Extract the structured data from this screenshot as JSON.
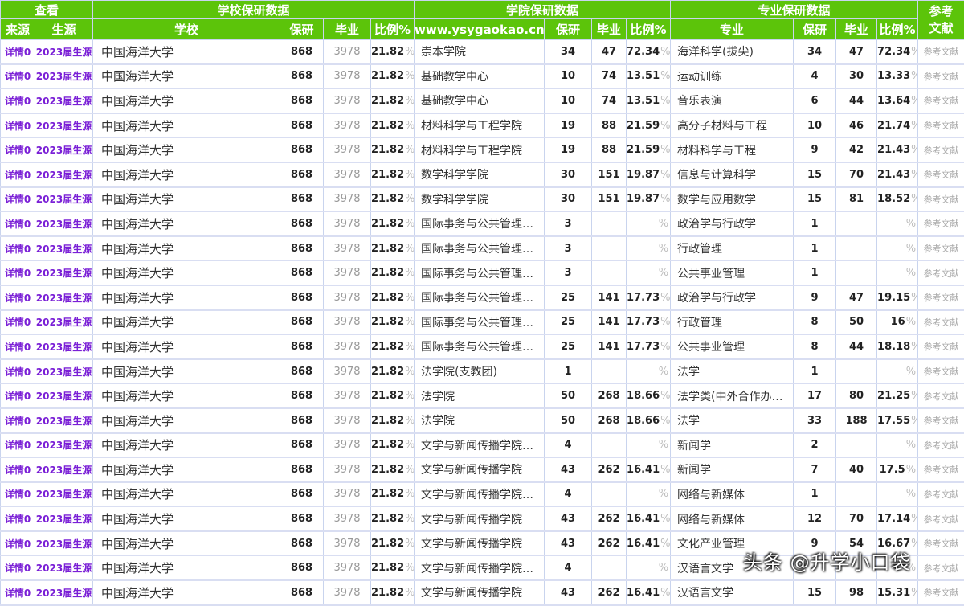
{
  "header": {
    "view": "查看",
    "school_group": "学校保研数据",
    "college_group": "学院保研数据",
    "major_group": "专业保研数据",
    "ref_line1": "参考",
    "ref_line2": "文献",
    "source": "来源",
    "students": "生源",
    "school": "学校",
    "baoyan": "保研",
    "graduates": "毕业",
    "ratio": "比例%",
    "url": "www.ysygaokao.cn",
    "major": "专业"
  },
  "pct": "%",
  "rows": [
    {
      "link": "详情0",
      "students": "2023届生源",
      "school": "中国海洋大学",
      "s_by": "868",
      "s_grad": "3978",
      "s_ratio": "21.82",
      "college": "崇本学院",
      "c_by": "34",
      "c_grad": "47",
      "c_ratio": "72.34",
      "major": "海洋科学(拔尖)",
      "m_by": "34",
      "m_grad": "47",
      "m_ratio": "72.34",
      "ref": "参考文献"
    },
    {
      "link": "详情0",
      "students": "2023届生源",
      "school": "中国海洋大学",
      "s_by": "868",
      "s_grad": "3978",
      "s_ratio": "21.82",
      "college": "基础教学中心",
      "c_by": "10",
      "c_grad": "74",
      "c_ratio": "13.51",
      "major": "运动训练",
      "m_by": "4",
      "m_grad": "30",
      "m_ratio": "13.33",
      "ref": "参考文献"
    },
    {
      "link": "详情0",
      "students": "2023届生源",
      "school": "中国海洋大学",
      "s_by": "868",
      "s_grad": "3978",
      "s_ratio": "21.82",
      "college": "基础教学中心",
      "c_by": "10",
      "c_grad": "74",
      "c_ratio": "13.51",
      "major": "音乐表演",
      "m_by": "6",
      "m_grad": "44",
      "m_ratio": "13.64",
      "ref": "参考文献"
    },
    {
      "link": "详情0",
      "students": "2023届生源",
      "school": "中国海洋大学",
      "s_by": "868",
      "s_grad": "3978",
      "s_ratio": "21.82",
      "college": "材料科学与工程学院",
      "c_by": "19",
      "c_grad": "88",
      "c_ratio": "21.59",
      "major": "高分子材料与工程",
      "m_by": "10",
      "m_grad": "46",
      "m_ratio": "21.74",
      "ref": "参考文献"
    },
    {
      "link": "详情0",
      "students": "2023届生源",
      "school": "中国海洋大学",
      "s_by": "868",
      "s_grad": "3978",
      "s_ratio": "21.82",
      "college": "材料科学与工程学院",
      "c_by": "19",
      "c_grad": "88",
      "c_ratio": "21.59",
      "major": "材料科学与工程",
      "m_by": "9",
      "m_grad": "42",
      "m_ratio": "21.43",
      "ref": "参考文献"
    },
    {
      "link": "详情0",
      "students": "2023届生源",
      "school": "中国海洋大学",
      "s_by": "868",
      "s_grad": "3978",
      "s_ratio": "21.82",
      "college": "数学科学学院",
      "c_by": "30",
      "c_grad": "151",
      "c_ratio": "19.87",
      "major": "信息与计算科学",
      "m_by": "15",
      "m_grad": "70",
      "m_ratio": "21.43",
      "ref": "参考文献"
    },
    {
      "link": "详情0",
      "students": "2023届生源",
      "school": "中国海洋大学",
      "s_by": "868",
      "s_grad": "3978",
      "s_ratio": "21.82",
      "college": "数学科学学院",
      "c_by": "30",
      "c_grad": "151",
      "c_ratio": "19.87",
      "major": "数学与应用数学",
      "m_by": "15",
      "m_grad": "81",
      "m_ratio": "18.52",
      "ref": "参考文献"
    },
    {
      "link": "详情0",
      "students": "2023届生源",
      "school": "中国海洋大学",
      "s_by": "868",
      "s_grad": "3978",
      "s_ratio": "21.82",
      "college": "国际事务与公共管理…",
      "c_by": "3",
      "c_grad": "",
      "c_ratio": "",
      "major": "政治学与行政学",
      "m_by": "1",
      "m_grad": "",
      "m_ratio": "",
      "ref": "参考文献"
    },
    {
      "link": "详情0",
      "students": "2023届生源",
      "school": "中国海洋大学",
      "s_by": "868",
      "s_grad": "3978",
      "s_ratio": "21.82",
      "college": "国际事务与公共管理…",
      "c_by": "3",
      "c_grad": "",
      "c_ratio": "",
      "major": "行政管理",
      "m_by": "1",
      "m_grad": "",
      "m_ratio": "",
      "ref": "参考文献"
    },
    {
      "link": "详情0",
      "students": "2023届生源",
      "school": "中国海洋大学",
      "s_by": "868",
      "s_grad": "3978",
      "s_ratio": "21.82",
      "college": "国际事务与公共管理…",
      "c_by": "3",
      "c_grad": "",
      "c_ratio": "",
      "major": "公共事业管理",
      "m_by": "1",
      "m_grad": "",
      "m_ratio": "",
      "ref": "参考文献"
    },
    {
      "link": "详情0",
      "students": "2023届生源",
      "school": "中国海洋大学",
      "s_by": "868",
      "s_grad": "3978",
      "s_ratio": "21.82",
      "college": "国际事务与公共管理…",
      "c_by": "25",
      "c_grad": "141",
      "c_ratio": "17.73",
      "major": "政治学与行政学",
      "m_by": "9",
      "m_grad": "47",
      "m_ratio": "19.15",
      "ref": "参考文献"
    },
    {
      "link": "详情0",
      "students": "2023届生源",
      "school": "中国海洋大学",
      "s_by": "868",
      "s_grad": "3978",
      "s_ratio": "21.82",
      "college": "国际事务与公共管理…",
      "c_by": "25",
      "c_grad": "141",
      "c_ratio": "17.73",
      "major": "行政管理",
      "m_by": "8",
      "m_grad": "50",
      "m_ratio": "16",
      "ref": "参考文献"
    },
    {
      "link": "详情0",
      "students": "2023届生源",
      "school": "中国海洋大学",
      "s_by": "868",
      "s_grad": "3978",
      "s_ratio": "21.82",
      "college": "国际事务与公共管理…",
      "c_by": "25",
      "c_grad": "141",
      "c_ratio": "17.73",
      "major": "公共事业管理",
      "m_by": "8",
      "m_grad": "44",
      "m_ratio": "18.18",
      "ref": "参考文献"
    },
    {
      "link": "详情0",
      "students": "2023届生源",
      "school": "中国海洋大学",
      "s_by": "868",
      "s_grad": "3978",
      "s_ratio": "21.82",
      "college": "法学院(支教团)",
      "c_by": "1",
      "c_grad": "",
      "c_ratio": "",
      "major": "法学",
      "m_by": "1",
      "m_grad": "",
      "m_ratio": "",
      "ref": "参考文献"
    },
    {
      "link": "详情0",
      "students": "2023届生源",
      "school": "中国海洋大学",
      "s_by": "868",
      "s_grad": "3978",
      "s_ratio": "21.82",
      "college": "法学院",
      "c_by": "50",
      "c_grad": "268",
      "c_ratio": "18.66",
      "major": "法学类(中外合作办…",
      "m_by": "17",
      "m_grad": "80",
      "m_ratio": "21.25",
      "ref": "参考文献"
    },
    {
      "link": "详情0",
      "students": "2023届生源",
      "school": "中国海洋大学",
      "s_by": "868",
      "s_grad": "3978",
      "s_ratio": "21.82",
      "college": "法学院",
      "c_by": "50",
      "c_grad": "268",
      "c_ratio": "18.66",
      "major": "法学",
      "m_by": "33",
      "m_grad": "188",
      "m_ratio": "17.55",
      "ref": "参考文献"
    },
    {
      "link": "详情0",
      "students": "2023届生源",
      "school": "中国海洋大学",
      "s_by": "868",
      "s_grad": "3978",
      "s_ratio": "21.82",
      "college": "文学与新闻传播学院…",
      "c_by": "4",
      "c_grad": "",
      "c_ratio": "",
      "major": "新闻学",
      "m_by": "2",
      "m_grad": "",
      "m_ratio": "",
      "ref": "参考文献"
    },
    {
      "link": "详情0",
      "students": "2023届生源",
      "school": "中国海洋大学",
      "s_by": "868",
      "s_grad": "3978",
      "s_ratio": "21.82",
      "college": "文学与新闻传播学院",
      "c_by": "43",
      "c_grad": "262",
      "c_ratio": "16.41",
      "major": "新闻学",
      "m_by": "7",
      "m_grad": "40",
      "m_ratio": "17.5",
      "ref": "参考文献"
    },
    {
      "link": "详情0",
      "students": "2023届生源",
      "school": "中国海洋大学",
      "s_by": "868",
      "s_grad": "3978",
      "s_ratio": "21.82",
      "college": "文学与新闻传播学院…",
      "c_by": "4",
      "c_grad": "",
      "c_ratio": "",
      "major": "网络与新媒体",
      "m_by": "1",
      "m_grad": "",
      "m_ratio": "",
      "ref": "参考文献"
    },
    {
      "link": "详情0",
      "students": "2023届生源",
      "school": "中国海洋大学",
      "s_by": "868",
      "s_grad": "3978",
      "s_ratio": "21.82",
      "college": "文学与新闻传播学院",
      "c_by": "43",
      "c_grad": "262",
      "c_ratio": "16.41",
      "major": "网络与新媒体",
      "m_by": "12",
      "m_grad": "70",
      "m_ratio": "17.14",
      "ref": "参考文献"
    },
    {
      "link": "详情0",
      "students": "2023届生源",
      "school": "中国海洋大学",
      "s_by": "868",
      "s_grad": "3978",
      "s_ratio": "21.82",
      "college": "文学与新闻传播学院",
      "c_by": "43",
      "c_grad": "262",
      "c_ratio": "16.41",
      "major": "文化产业管理",
      "m_by": "9",
      "m_grad": "54",
      "m_ratio": "16.67",
      "ref": "参考文献"
    },
    {
      "link": "详情0",
      "students": "2023届生源",
      "school": "中国海洋大学",
      "s_by": "868",
      "s_grad": "3978",
      "s_ratio": "21.82",
      "college": "文学与新闻传播学院…",
      "c_by": "4",
      "c_grad": "",
      "c_ratio": "",
      "major": "汉语言文学",
      "m_by": "",
      "m_grad": "",
      "m_ratio": "",
      "ref": "参考文献"
    },
    {
      "link": "详情0",
      "students": "2023届生源",
      "school": "中国海洋大学",
      "s_by": "868",
      "s_grad": "3978",
      "s_ratio": "21.82",
      "college": "文学与新闻传播学院",
      "c_by": "43",
      "c_grad": "262",
      "c_ratio": "16.41",
      "major": "汉语言文学",
      "m_by": "15",
      "m_grad": "98",
      "m_ratio": "15.31",
      "ref": "参考文献"
    }
  ],
  "watermark": "头条 @升学小口袋"
}
